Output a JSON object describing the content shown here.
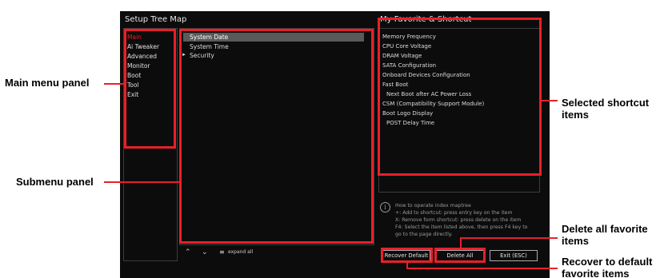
{
  "left_panel": {
    "title": "Setup Tree Map"
  },
  "main_menu": [
    "Main",
    "Ai Tweaker",
    "Advanced",
    "Monitor",
    "Boot",
    "Tool",
    "Exit"
  ],
  "submenu": [
    {
      "label": "System Date",
      "selected": true
    },
    {
      "label": "System Time",
      "selected": false
    },
    {
      "label": "Security",
      "selected": false,
      "has_arrow": true
    }
  ],
  "favorites": {
    "title": "My Favorite & Shortcut",
    "items": [
      {
        "label": "Memory Frequency",
        "indent": false
      },
      {
        "label": "CPU Core Voltage",
        "indent": false
      },
      {
        "label": "DRAM Voltage",
        "indent": false
      },
      {
        "label": "SATA Configuration",
        "indent": false
      },
      {
        "label": "Onboard Devices Configuration",
        "indent": false
      },
      {
        "label": "Fast Boot",
        "indent": false
      },
      {
        "label": "Next Boot after AC Power Loss",
        "indent": true
      },
      {
        "label": "CSM (Compatibility Support Module)",
        "indent": false
      },
      {
        "label": "Boot Logo Display",
        "indent": false
      },
      {
        "label": "POST Delay Time",
        "indent": true
      }
    ]
  },
  "help": {
    "lines": [
      "How to operate index maptree",
      "+: Add to shortcut: press entry key on the item",
      "X: Remove form shortcut: press delete on the item",
      "F4: Select the item listed above, then press F4 key to",
      "go to the page directly."
    ]
  },
  "buttons": {
    "recover_default": "Recover Default",
    "delete_all": "Delete All",
    "exit": "Exit (ESC)"
  },
  "bottom_controls": {
    "expand_all": "expand all"
  },
  "callouts": {
    "main_menu_panel": "Main menu panel",
    "submenu_panel": "Submenu panel",
    "selected_shortcut": "Selected shortcut items",
    "delete_all_favorite": "Delete all favorite items",
    "recover_default_favorite": "Recover to default favorite items"
  },
  "colors": {
    "accent": "#e8202a",
    "background": "#0c0c0c",
    "selection": "#5a5a5a"
  }
}
